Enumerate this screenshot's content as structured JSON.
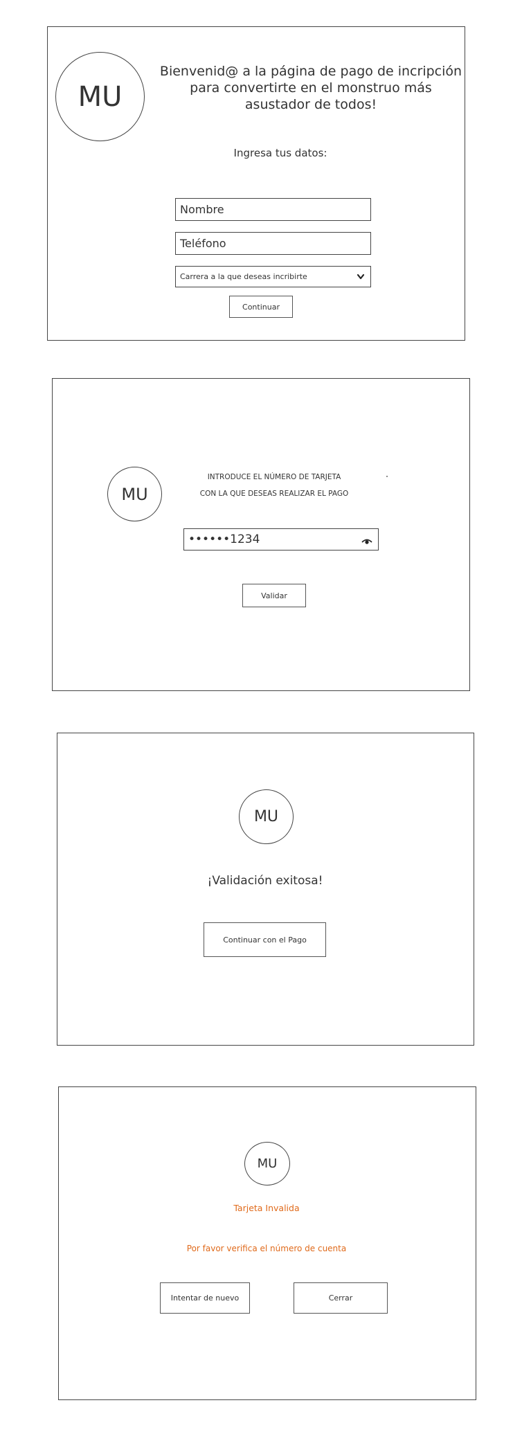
{
  "colors": {
    "line": "#444444",
    "error": "#e06a1b",
    "background": "#ffffff"
  },
  "screens": {
    "registration": {
      "logo": "MU",
      "welcome_lines": [
        "Bienvenid@ a la página de pago de incripción",
        "para convertirte en el monstruo más",
        "asustador de todos!"
      ],
      "instructions": "Ingresa tus datos:",
      "name_placeholder": "Nombre",
      "phone_placeholder": "Teléfono",
      "career_select": "Carrera a la que deseas incribirte",
      "continue_label": "Continuar"
    },
    "card_entry": {
      "logo": "MU",
      "prompt_lines": [
        "INTRODUCE EL NÚMERO DE TARJETA",
        "CON LA QUE DESEAS REALIZAR EL PAGO"
      ],
      "card_value": "••••••1234",
      "eye_icon": "eye-icon",
      "validate_label": "Validar"
    },
    "success": {
      "logo": "MU",
      "message": "¡Validación exitosa!",
      "continue_label": "Continuar con el Pago"
    },
    "error": {
      "logo": "MU",
      "title": "Tarjeta Invalida",
      "message": "Por favor verifica el número de cuenta",
      "retry_label": "Intentar de nuevo",
      "close_label": "Cerrar"
    }
  }
}
